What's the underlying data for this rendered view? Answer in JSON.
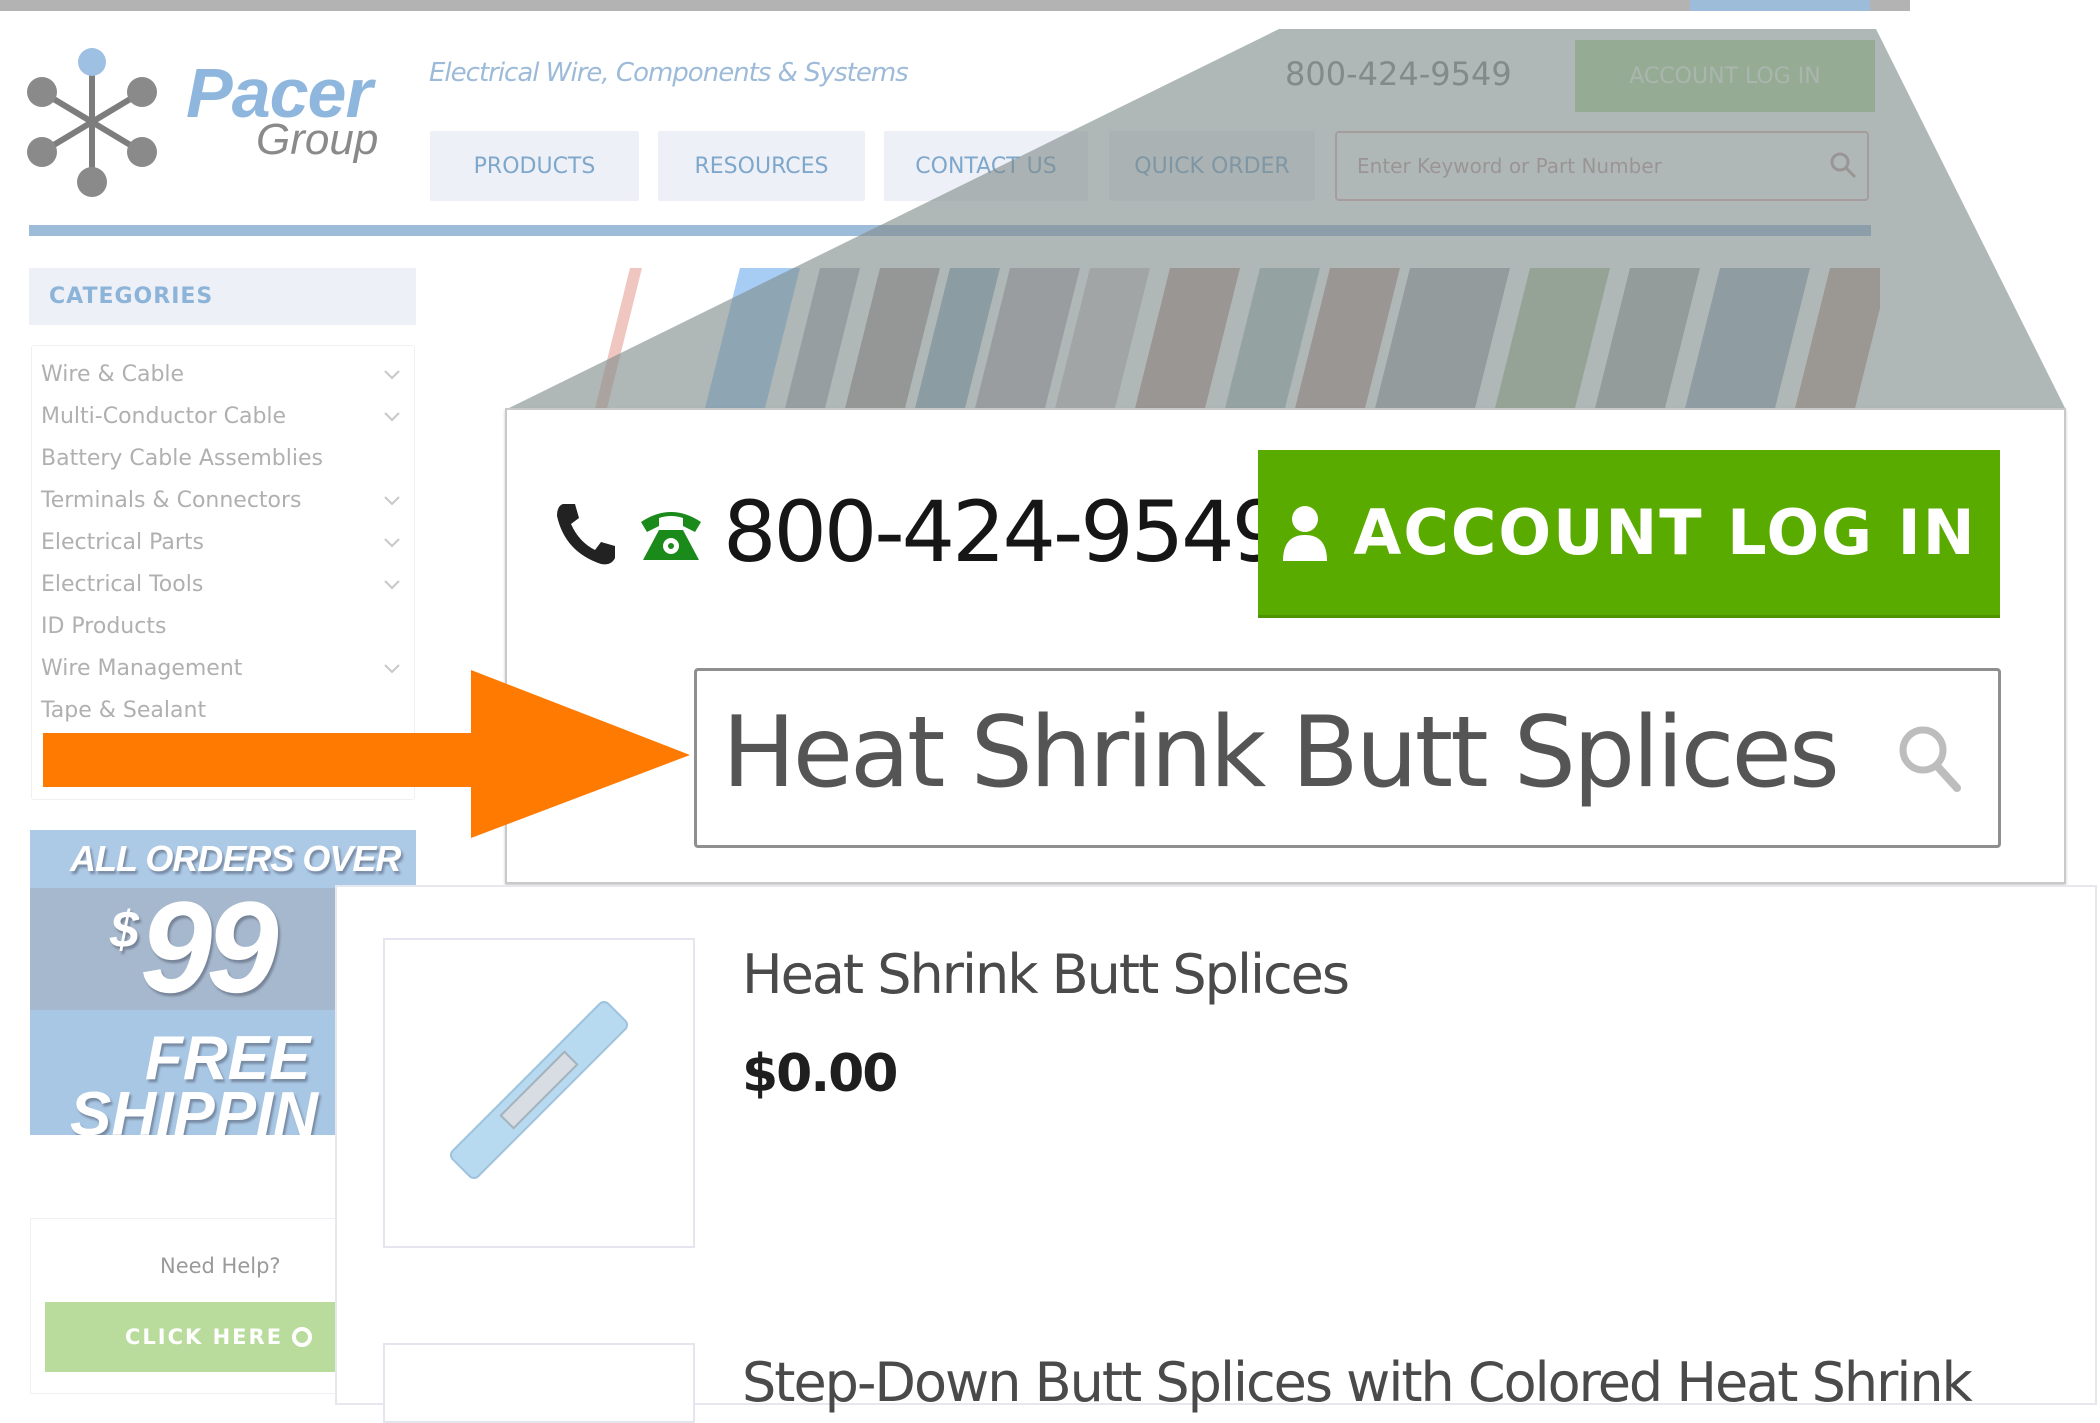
{
  "header": {
    "brand_name": "Pacer",
    "brand_sub": "Group",
    "tagline": "Electrical Wire, Components & Systems",
    "phone": "800-424-9549",
    "login_label": "ACCOUNT LOG IN",
    "nav": [
      {
        "label": "PRODUCTS"
      },
      {
        "label": "RESOURCES"
      },
      {
        "label": "CONTACT US"
      },
      {
        "label": "QUICK ORDER"
      }
    ],
    "search_placeholder": "Enter Keyword or Part Number"
  },
  "sidebar": {
    "categories_title": "CATEGORIES",
    "categories": [
      {
        "label": "Wire & Cable",
        "expandable": true
      },
      {
        "label": "Multi-Conductor Cable",
        "expandable": true
      },
      {
        "label": "Battery Cable Assemblies",
        "expandable": false
      },
      {
        "label": "Terminals & Connectors",
        "expandable": true
      },
      {
        "label": "Electrical Parts",
        "expandable": true
      },
      {
        "label": "Electrical Tools",
        "expandable": true
      },
      {
        "label": "ID Products",
        "expandable": false
      },
      {
        "label": "Wire Management",
        "expandable": true
      },
      {
        "label": "Tape & Sealant",
        "expandable": false
      }
    ],
    "promo": {
      "line1": "ALL ORDERS OVER",
      "currency": "$",
      "amount": "99",
      "line3": "FREE",
      "line4": "SHIPPIN"
    },
    "help": {
      "label": "Need Help?",
      "button_label": "CLICK HERE"
    }
  },
  "callout": {
    "phone": "800-424-9549",
    "login_label": "ACCOUNT LOG IN",
    "search_value": "Heat Shrink Butt Splices"
  },
  "search_results": [
    {
      "title": "Heat Shrink Butt Splices",
      "price": "$0.00"
    },
    {
      "title": "Step-Down Butt Splices with Colored Heat Shrink"
    }
  ],
  "colors": {
    "brand_blue": "#8fb7de",
    "login_green": "#5aab00",
    "arrow_orange": "#ff7a00",
    "overlay_gray": "#8e9898"
  }
}
